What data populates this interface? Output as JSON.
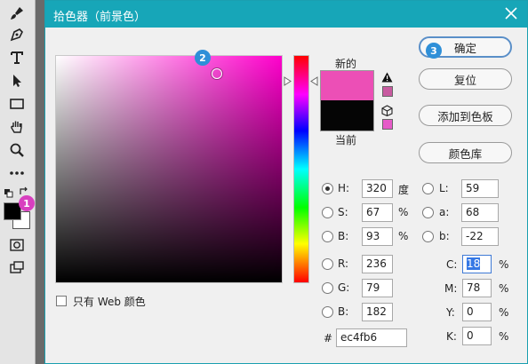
{
  "window": {
    "title": "拾色器（前景色）"
  },
  "toolbar": {
    "icons": [
      "brush-icon",
      "pen-icon",
      "type-icon",
      "path-select-icon",
      "rectangle-icon",
      "hand-icon",
      "zoom-icon",
      "more-icon",
      "default-colors-icon",
      "swap-colors-icon",
      "quick-mask-icon",
      "screen-mode-icon"
    ],
    "foreground_color": "#000000",
    "background_color": "#ffffff",
    "badge_1": "1"
  },
  "picker": {
    "badge_2": "2",
    "new_label": "新的",
    "current_label": "当前",
    "new_color": "#ec4fb6",
    "current_color": "#050505"
  },
  "buttons": {
    "ok": "确定",
    "ok_badge": "3",
    "reset": "复位",
    "add_to_swatches": "添加到色板",
    "color_libraries": "颜色库"
  },
  "fields": {
    "H": {
      "label": "H:",
      "value": "320",
      "unit": "度"
    },
    "S": {
      "label": "S:",
      "value": "67",
      "unit": "%"
    },
    "Bhsb": {
      "label": "B:",
      "value": "93",
      "unit": "%"
    },
    "R": {
      "label": "R:",
      "value": "236"
    },
    "G": {
      "label": "G:",
      "value": "79"
    },
    "Brgb": {
      "label": "B:",
      "value": "182"
    },
    "L": {
      "label": "L:",
      "value": "59"
    },
    "a": {
      "label": "a:",
      "value": "68"
    },
    "b": {
      "label": "b:",
      "value": "-22"
    },
    "C": {
      "label": "C:",
      "value": "18",
      "unit": "%"
    },
    "M": {
      "label": "M:",
      "value": "78",
      "unit": "%"
    },
    "Y": {
      "label": "Y:",
      "value": "0",
      "unit": "%"
    },
    "K": {
      "label": "K:",
      "value": "0",
      "unit": "%"
    },
    "hex": {
      "label": "#",
      "value": "ec4fb6"
    }
  },
  "web_only": {
    "label": "只有 Web 颜色",
    "checked": false
  },
  "colors": {
    "accent": "#17a6b8",
    "badge": "#2e8fd8",
    "badge_pink": "#d83fbf"
  }
}
